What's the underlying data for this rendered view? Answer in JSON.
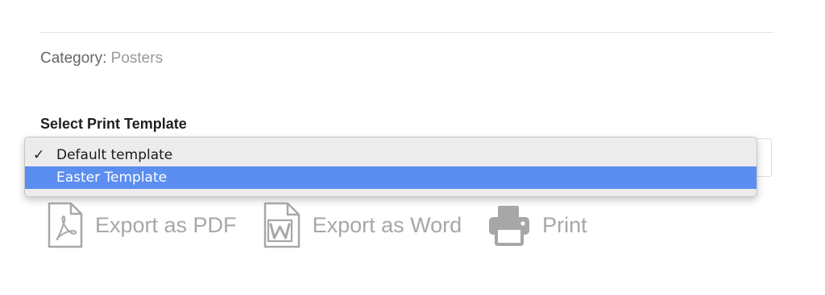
{
  "category": {
    "label": "Category:",
    "value": "Posters"
  },
  "template_select": {
    "label": "Select Print Template",
    "options": [
      {
        "label": "Default template",
        "checked": true,
        "highlighted": false
      },
      {
        "label": "Easter Template",
        "checked": false,
        "highlighted": true
      }
    ],
    "check_glyph": "✓"
  },
  "actions": {
    "pdf": {
      "label": "Export as PDF",
      "icon": "pdf-file-icon"
    },
    "word": {
      "label": "Export as Word",
      "icon": "word-file-icon"
    },
    "print": {
      "label": "Print",
      "icon": "printer-icon"
    }
  },
  "colors": {
    "highlight": "#5b8ef0",
    "muted_text": "#a7a7a7",
    "popup_bg": "#ececec"
  }
}
